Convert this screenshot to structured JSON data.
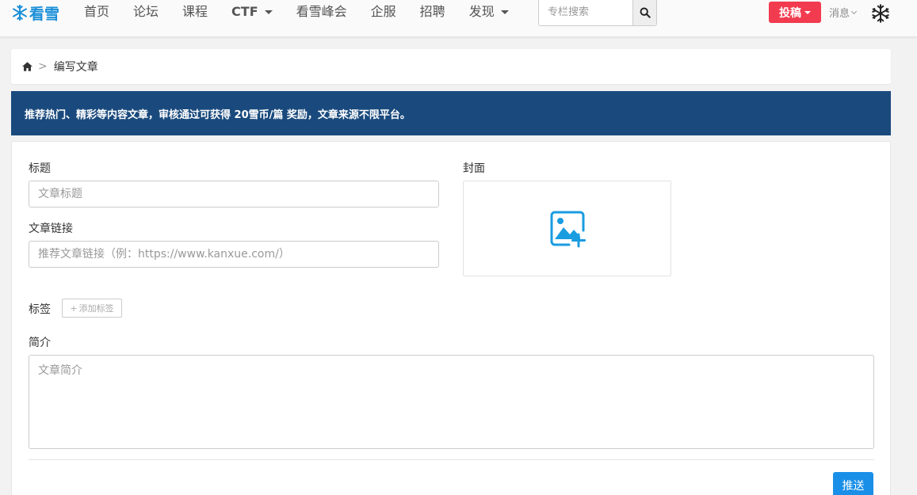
{
  "brand": {
    "logo_text": "看雪",
    "accent_color": "#1a8fd8"
  },
  "nav": {
    "items": [
      {
        "label": "首页",
        "dropdown": false
      },
      {
        "label": "论坛",
        "dropdown": false
      },
      {
        "label": "课程",
        "dropdown": false
      },
      {
        "label": "CTF",
        "dropdown": true
      },
      {
        "label": "看雪峰会",
        "dropdown": false
      },
      {
        "label": "企服",
        "dropdown": false
      },
      {
        "label": "招聘",
        "dropdown": false
      },
      {
        "label": "发现",
        "dropdown": true
      }
    ]
  },
  "search": {
    "placeholder": "专栏搜索",
    "icon": "search-icon"
  },
  "header_actions": {
    "submit_label": "投稿",
    "submit_color": "#f23b4f",
    "messages_label": "消息"
  },
  "breadcrumb": {
    "home_icon": "home-icon",
    "separator": ">",
    "current": "编写文章"
  },
  "notice": {
    "text": "推荐热门、精彩等内容文章，审核通过可获得 20雪币/篇 奖励，文章来源不限平台。",
    "bg_color": "#1a4a7d"
  },
  "form": {
    "title_label": "标题",
    "title_placeholder": "文章标题",
    "link_label": "文章链接",
    "link_placeholder": "推荐文章链接（例：https://www.kanxue.com/）",
    "cover_label": "封面",
    "cover_icon": "add-image-icon",
    "tags_label": "标签",
    "add_tag_label": "添加标签",
    "summary_label": "简介",
    "summary_placeholder": "文章简介",
    "push_label": "推送",
    "push_color": "#1a8fe8"
  }
}
